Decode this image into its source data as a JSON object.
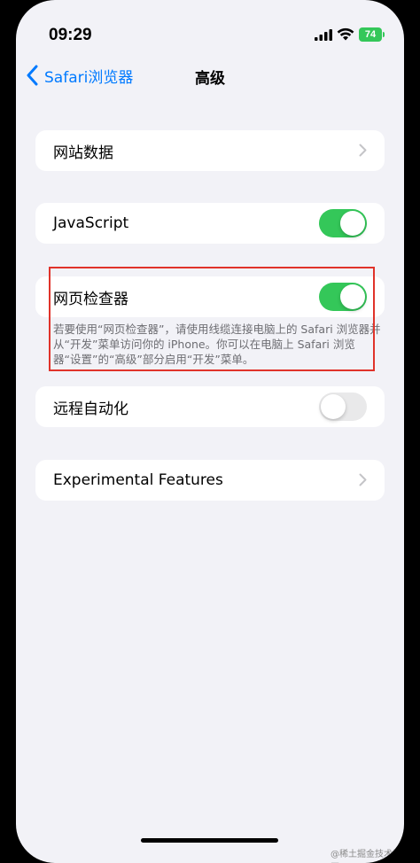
{
  "status_bar": {
    "time": "09:29",
    "battery": "74",
    "icons": [
      "signal-icon",
      "wifi-icon",
      "battery-icon"
    ]
  },
  "nav": {
    "back_label": "Safari浏览器",
    "title": "高级"
  },
  "rows": {
    "website_data": "网站数据",
    "javascript": {
      "label": "JavaScript",
      "on": true
    },
    "web_inspector": {
      "label": "网页检查器",
      "on": true
    },
    "web_inspector_note": "若要使用“网页检查器”，请使用线缆连接电脑上的 Safari 浏览器并从“开发”菜单访问你的 iPhone。你可以在电脑上 Safari 浏览器“设置”的“高级”部分启用“开发”菜单。",
    "remote_automation": {
      "label": "远程自动化",
      "on": false
    },
    "experimental_features": "Experimental Features"
  },
  "colors": {
    "accent": "#007aff",
    "toggle_on": "#34c759",
    "highlight": "#e0332a",
    "background": "#f2f2f7"
  },
  "watermark": "@稀土掘金技术社区"
}
